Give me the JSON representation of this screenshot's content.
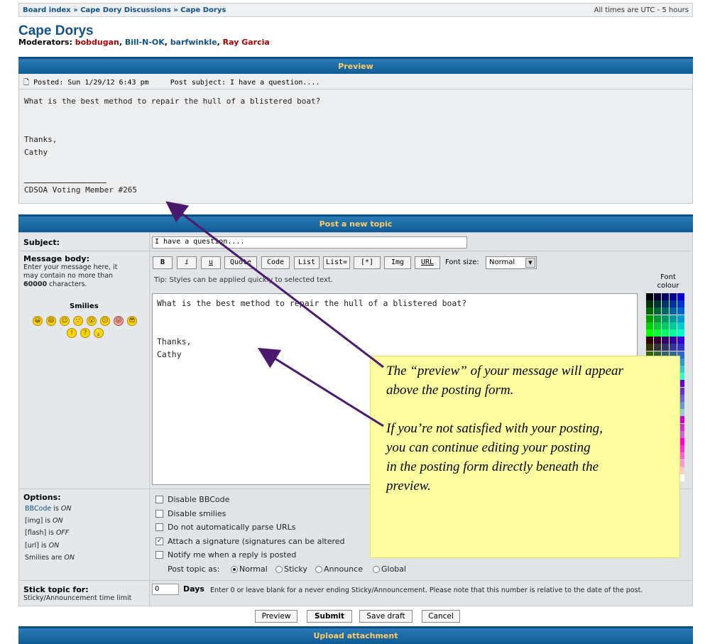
{
  "breadcrumb": {
    "items": [
      "Board index",
      "Cape Dory Discussions",
      "Cape Dorys"
    ],
    "sep": "»",
    "timezone": "All times are UTC - 5 hours"
  },
  "forum": {
    "title": "Cape Dorys",
    "moderators_label": "Moderators:",
    "moderators": [
      "bobdugan",
      "Bill-N-OK",
      "barfwinkle",
      "Ray Garcia"
    ]
  },
  "preview": {
    "header": "Preview",
    "posted": "Posted: Sun 1/29/12 6:43 pm",
    "subject": "Post subject: I have a question....",
    "body": "What is the best method to repair the hull of a blistered boat?\n\n\nThanks,\nCathy",
    "signature": "CDSOA Voting Member #265"
  },
  "form": {
    "header": "Post a new topic",
    "subject_label": "Subject:",
    "subject_value": "I have a question....",
    "message_label": "Message body:",
    "message_help_1": "Enter your message here, it",
    "message_help_2": "may contain no more than",
    "message_help_3": "60000",
    "message_help_4": " characters.",
    "toolbar": [
      "B",
      "i",
      "u",
      "Quote",
      "Code",
      "List",
      "List=",
      "[*]",
      "Img",
      "URL"
    ],
    "font_size_label": "Font size:",
    "font_size_value": "Normal",
    "tip": "Tip: Styles can be applied quickly to selected text.",
    "font_colour_label": "Font colour",
    "message_value": "What is the best method to repair the hull of a blistered boat?\n\n\nThanks,\nCathy",
    "smilies_label": "Smilies",
    "smilies_row1": [
      "😀",
      "😄",
      "😉",
      "🙂",
      "😮",
      "😕",
      "😛",
      "😎"
    ],
    "smilies_row2": [
      "!",
      "?",
      "💡"
    ],
    "options_label": "Options:",
    "options_status": {
      "bbcode": "BBCode",
      "bbcode_rest": " is ",
      "bbcode_state": "ON",
      "img": "[img] is ",
      "img_state": "ON",
      "flash": "[flash] is ",
      "flash_state": "OFF",
      "url": "[url] is ",
      "url_state": "ON",
      "smilies": "Smilies are ",
      "smilies_state": "ON"
    },
    "checkboxes": [
      {
        "label": "Disable BBCode",
        "checked": false
      },
      {
        "label": "Disable smilies",
        "checked": false
      },
      {
        "label": "Do not automatically parse URLs",
        "checked": false
      },
      {
        "label": "Attach a signature (signatures can be altered",
        "checked": true
      },
      {
        "label": "Notify me when a reply is posted",
        "checked": false
      }
    ],
    "post_topic_as_label": "Post topic as:",
    "post_topic_options": [
      "Normal",
      "Sticky",
      "Announce",
      "Global"
    ],
    "post_topic_selected": "Normal",
    "stick_label": "Stick topic for:",
    "stick_sub": "Sticky/Announcement time limit",
    "stick_value": "0",
    "days_label": "Days",
    "days_note": "Enter 0 or leave blank for a never ending Sticky/Announcement. Please note that this number is relative to the date of the post.",
    "buttons": [
      "Preview",
      "Submit",
      "Save draft",
      "Cancel"
    ]
  },
  "upload": {
    "header": "Upload attachment"
  },
  "annotation": {
    "text": "The “preview” of your message will appear\nabove the posting form.\n\nIf you’re not satisfied with your posting,\nyou can continue editing your posting\nin the posting form directly beneath the\npreview."
  },
  "colors": {
    "accent": "#105289",
    "header_text": "#ffcc66",
    "note_bg": "#ffffa0",
    "arrow": "#4b1a6e"
  }
}
